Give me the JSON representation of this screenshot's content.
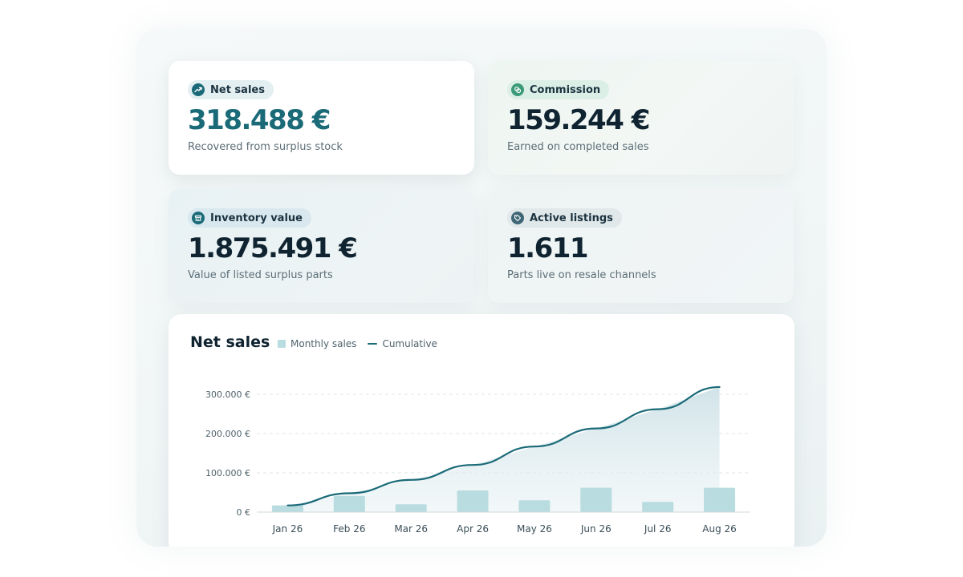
{
  "kpis": {
    "net_sales": {
      "label": "Net sales",
      "value": "318.488 €",
      "caption": "Recovered from surplus stock",
      "icon": "trending-up-icon"
    },
    "commission": {
      "label": "Commission",
      "value": "159.244 €",
      "caption": "Earned on completed sales",
      "icon": "coins-icon"
    },
    "inventory": {
      "label": "Inventory value",
      "value": "1.875.491 €",
      "caption": "Value of listed surplus parts",
      "icon": "store-icon"
    },
    "listings": {
      "label": "Active listings",
      "value": "1.611",
      "caption": "Parts live on resale channels",
      "icon": "tag-icon"
    }
  },
  "colors": {
    "teal": "#1a6a78",
    "bar": "#b9dce0",
    "green_icon": "#3a9a7a"
  },
  "chart": {
    "title": "Net sales",
    "legend_bar": "Monthly sales",
    "legend_line": "Cumulative"
  },
  "chart_data": {
    "type": "bar",
    "categories": [
      "Jan 26",
      "Feb 26",
      "Mar 26",
      "Apr 26",
      "May 26",
      "Jun 26",
      "Jul 26",
      "Aug 26"
    ],
    "series": [
      {
        "name": "Monthly sales",
        "type": "bar",
        "values": [
          17000,
          41000,
          20000,
          55000,
          30000,
          62000,
          26000,
          62000
        ]
      },
      {
        "name": "Cumulative",
        "type": "line",
        "values": [
          17000,
          48000,
          82000,
          120000,
          167000,
          213000,
          262000,
          318488
        ]
      }
    ],
    "y_ticks": [
      "0 €",
      "100.000 €",
      "200.000 €",
      "300.000 €"
    ],
    "ylim": [
      0,
      320000
    ],
    "grid": true,
    "legend": "top-left"
  }
}
